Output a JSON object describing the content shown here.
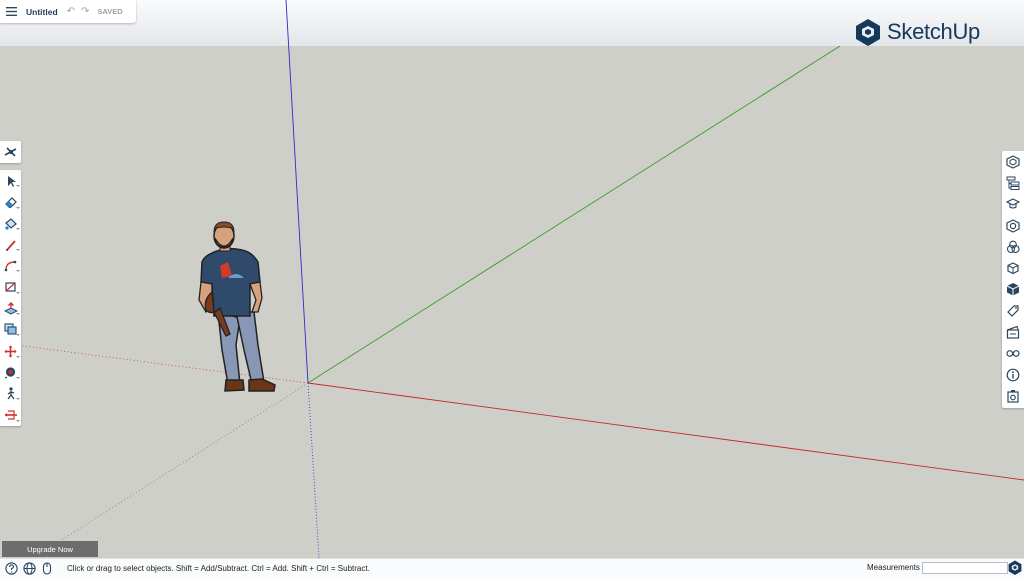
{
  "file": {
    "title": "Untitled",
    "status": "SAVED",
    "undo_glyph": "↶",
    "redo_glyph": "↷"
  },
  "brand": {
    "name": "SketchUp"
  },
  "left_toolbar": {
    "scenes_tool": "scenes-icon",
    "tools": [
      "select-tool",
      "eraser-tool",
      "paint-bucket-tool",
      "line-tool",
      "arc-tool",
      "rectangle-tool",
      "push-pull-tool",
      "offset-tool",
      "move-tool",
      "tape-measure-tool",
      "walk-tool",
      "section-plane-tool"
    ]
  },
  "right_panel": {
    "items": [
      "entity-info-icon",
      "outliner-icon",
      "instructor-icon",
      "components-icon",
      "materials-icon",
      "styles-icon",
      "solid-tools-icon",
      "tags-icon",
      "scenes-panel-icon",
      "display-icon",
      "model-info-icon",
      "export-icon"
    ]
  },
  "upgrade": {
    "label": "Upgrade Now"
  },
  "statusbar": {
    "hint": "Click or drag to select objects. Shift = Add/Subtract. Ctrl = Add. Shift + Ctrl = Subtract.",
    "measurements_label": "Measurements",
    "measurements_value": ""
  },
  "colors": {
    "red_axis": "#c62828",
    "green_axis": "#3a9a2a",
    "blue_axis": "#2e2ec2",
    "brand": "#15395b"
  }
}
